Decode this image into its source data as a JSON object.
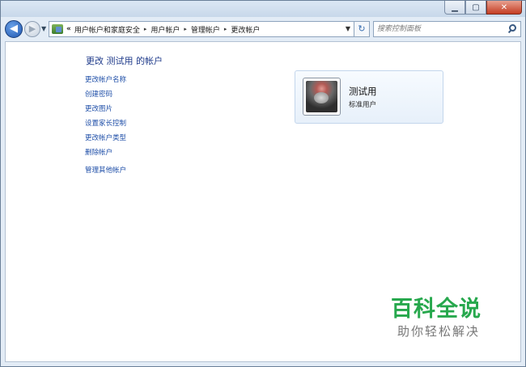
{
  "window": {
    "caption_buttons": {
      "minimize": "▁",
      "maximize": "▢",
      "close": "✕"
    }
  },
  "navbar": {
    "back_icon": "arrow-left-icon",
    "forward_icon": "arrow-right-icon",
    "breadcrumbs": [
      "用户帐户和家庭安全",
      "用户帐户",
      "管理帐户",
      "更改帐户"
    ],
    "overflow_chevron": "«",
    "separator": "▸",
    "search_placeholder": "搜索控制面板"
  },
  "main": {
    "title": "更改 测试用 的帐户",
    "tasks": [
      "更改帐户名称",
      "创建密码",
      "更改图片",
      "设置家长控制",
      "更改帐户类型",
      "删除帐户"
    ],
    "manage_other": "管理其他帐户"
  },
  "user_card": {
    "name": "测试用",
    "account_type": "标准用户"
  },
  "watermark": {
    "title": "百科全说",
    "subtitle": "助你轻松解决"
  },
  "colors": {
    "link": "#1f4fa8",
    "title": "#1e3a8a",
    "watermark_green": "#27a84d"
  }
}
